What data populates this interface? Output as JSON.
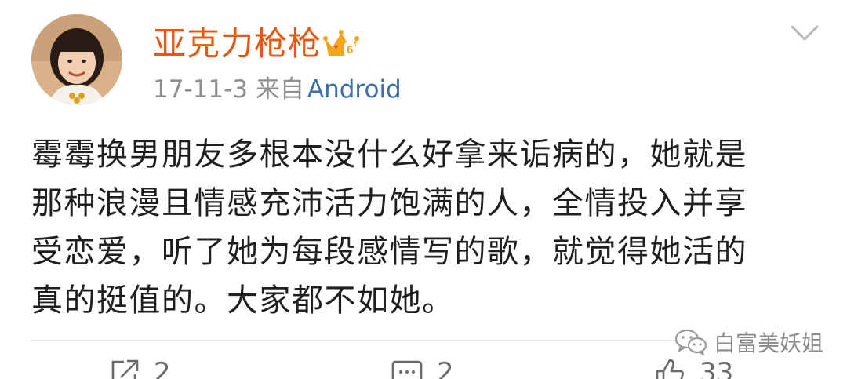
{
  "post": {
    "username": "亚克力枪枪",
    "date": "17-11-3",
    "source_prefix": "来自",
    "source": "Android",
    "content_lines": [
      "霉霉换男朋友多根本没什么好拿来诟病的，她就是",
      "那种浪漫且情感充沛活力饱满的人，全情投入并享",
      "受恋爱，听了她为每段感情写的歌，就觉得她活的",
      "真的挺值的。大家都不如她。"
    ]
  },
  "watermark": {
    "text": "白富美妖姐"
  },
  "actions": {
    "repost_count": "2",
    "comment_count": "2",
    "like_count": "33"
  },
  "colors": {
    "username": "#e8570f",
    "source_link": "#3f6fa8",
    "meta": "#8e8e8e",
    "body_text": "#1f1f1f"
  },
  "icons": [
    "avatar",
    "crown-badge-icon",
    "chevron-down-icon",
    "wechat-icon",
    "repost-icon",
    "comment-icon",
    "like-icon"
  ]
}
